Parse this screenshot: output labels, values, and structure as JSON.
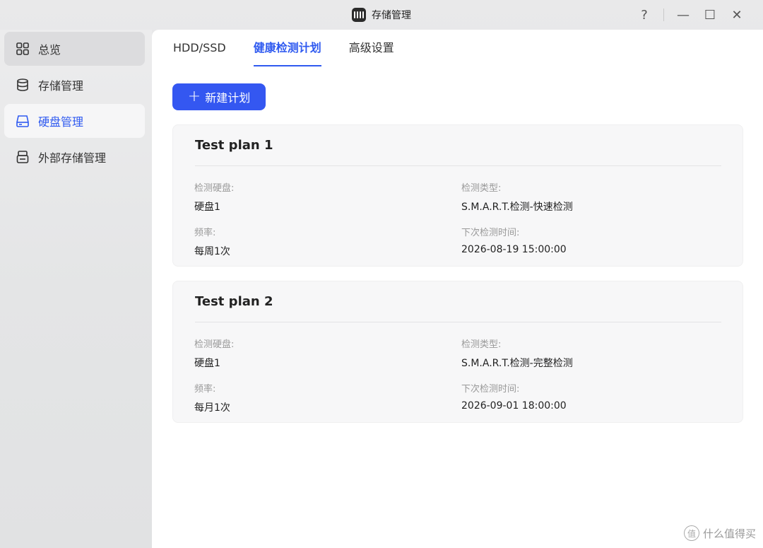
{
  "window": {
    "title": "存储管理",
    "help": "?",
    "minimize": "—",
    "maximize": "☐",
    "close": "✕"
  },
  "sidebar": {
    "items": [
      {
        "label": "总览",
        "icon": "grid-icon"
      },
      {
        "label": "存储管理",
        "icon": "database-icon"
      },
      {
        "label": "硬盘管理",
        "icon": "hard-disk-icon"
      },
      {
        "label": "外部存储管理",
        "icon": "external-storage-icon"
      }
    ],
    "active": "硬盘管理"
  },
  "tabs": [
    {
      "label": "HDD/SSD"
    },
    {
      "label": "健康检测计划"
    },
    {
      "label": "高级设置"
    }
  ],
  "active_tab": "健康检测计划",
  "new_plan_button": {
    "icon": "+",
    "label": "新建计划"
  },
  "plans": [
    {
      "title": "Test plan 1",
      "disk_label": "检测硬盘:",
      "disk_value": "硬盘1",
      "type_label": "检测类型:",
      "type_value": "S.M.A.R.T.检测-快速检测",
      "freq_label": "频率:",
      "freq_value": "每周1次",
      "next_label": "下次检测时间:",
      "next_value": "2026-08-19 15:00:00"
    },
    {
      "title": "Test plan 2",
      "disk_label": "检测硬盘:",
      "disk_value": "硬盘1",
      "type_label": "检测类型:",
      "type_value": "S.M.A.R.T.检测-完整检测",
      "freq_label": "频率:",
      "freq_value": "每月1次",
      "next_label": "下次检测时间:",
      "next_value": "2026-09-01 18:00:00"
    }
  ],
  "watermark": {
    "icon": "值",
    "text": "什么值得买"
  },
  "colors": {
    "accent": "#3457f1",
    "active_text": "#2f5af0"
  }
}
